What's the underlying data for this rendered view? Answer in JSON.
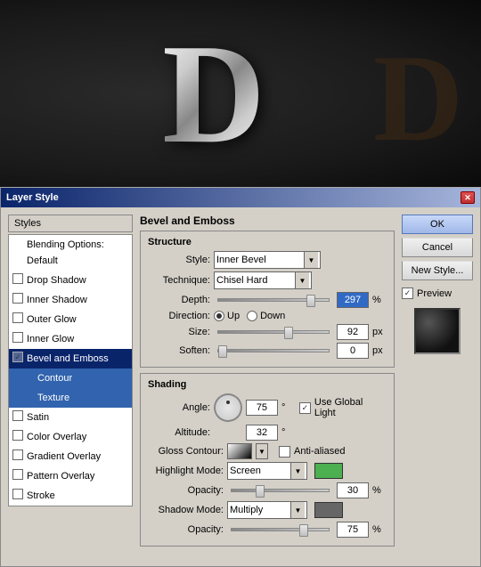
{
  "preview": {
    "letter": "D",
    "bg_letter": "D"
  },
  "dialog": {
    "title": "Layer Style",
    "close_label": "✕"
  },
  "left_panel": {
    "styles_label": "Styles",
    "blending_label": "Blending Options: Default",
    "items": [
      {
        "label": "Drop Shadow",
        "checked": false,
        "selected": false
      },
      {
        "label": "Inner Shadow",
        "checked": false,
        "selected": false
      },
      {
        "label": "Outer Glow",
        "checked": false,
        "selected": false
      },
      {
        "label": "Inner Glow",
        "checked": false,
        "selected": false
      },
      {
        "label": "Bevel and Emboss",
        "checked": true,
        "selected": true
      },
      {
        "label": "Contour",
        "checked": false,
        "selected": false,
        "sub": true
      },
      {
        "label": "Texture",
        "checked": false,
        "selected": true,
        "sub": true
      },
      {
        "label": "Satin",
        "checked": false,
        "selected": false
      },
      {
        "label": "Color Overlay",
        "checked": false,
        "selected": false
      },
      {
        "label": "Gradient Overlay",
        "checked": false,
        "selected": false
      },
      {
        "label": "Pattern Overlay",
        "checked": false,
        "selected": false
      },
      {
        "label": "Stroke",
        "checked": false,
        "selected": false
      }
    ]
  },
  "bevel_emboss": {
    "section_title": "Bevel and Emboss",
    "structure_title": "Structure",
    "style_label": "Style:",
    "style_value": "Inner Bevel",
    "technique_label": "Technique:",
    "technique_value": "Chisel Hard",
    "depth_label": "Depth:",
    "depth_value": "297",
    "depth_unit": "%",
    "direction_label": "Direction:",
    "direction_up": "Up",
    "direction_down": "Down",
    "size_label": "Size:",
    "size_value": "92",
    "size_unit": "px",
    "soften_label": "Soften:",
    "soften_value": "0",
    "soften_unit": "px",
    "shading_title": "Shading",
    "angle_label": "Angle:",
    "angle_value": "75",
    "angle_degree": "°",
    "use_global_light": "Use Global Light",
    "altitude_label": "Altitude:",
    "altitude_value": "32",
    "altitude_degree": "°",
    "gloss_contour_label": "Gloss Contour:",
    "anti_aliased_label": "Anti-aliased",
    "highlight_mode_label": "Highlight Mode:",
    "highlight_mode_value": "Screen",
    "highlight_opacity_label": "Opacity:",
    "highlight_opacity_value": "30",
    "highlight_opacity_unit": "%",
    "shadow_mode_label": "Shadow Mode:",
    "shadow_mode_value": "Multiply",
    "shadow_opacity_label": "Opacity:",
    "shadow_opacity_value": "75",
    "shadow_opacity_unit": "%"
  },
  "buttons": {
    "ok_label": "OK",
    "cancel_label": "Cancel",
    "new_style_label": "New Style...",
    "preview_label": "Preview"
  },
  "sliders": {
    "depth_pos": "80%",
    "size_pos": "60%",
    "soften_pos": "0%",
    "highlight_opacity_pos": "25%",
    "shadow_opacity_pos": "70%"
  },
  "colors": {
    "highlight_color": "#4caf50",
    "shadow_color": "#666666",
    "dialog_bg": "#d4d0c8",
    "selected_bg": "#0a246a",
    "sub_selected_bg": "#3163ae"
  }
}
